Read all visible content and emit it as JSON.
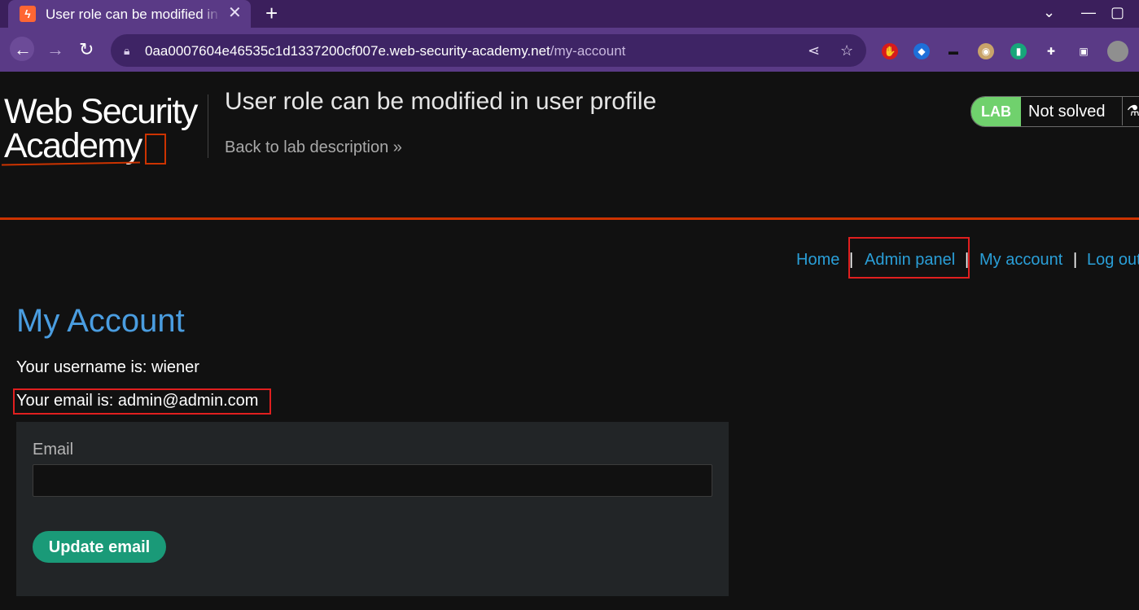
{
  "browser": {
    "tab_title": "User role can be modified in user profile",
    "tab_close": "✕",
    "new_tab": "+",
    "url_host": "0aa0007604e46535c1d1337200cf007e.web-security-academy.net",
    "url_path": "/my-account",
    "icons": [
      "back-arrow-icon",
      "forward-arrow-icon",
      "reload-icon",
      "lock-icon",
      "share-icon",
      "star-icon",
      "puzzle-icon",
      "sidebar-icon",
      "avatar"
    ],
    "window_controls": [
      "chevron-down-icon",
      "minimize-icon",
      "maximize-icon"
    ]
  },
  "header": {
    "logo_line1": "Web Security",
    "logo_line2": "Academy",
    "lab_title": "User role can be modified in user profile",
    "back_link": "Back to lab description",
    "back_chevrons": "»",
    "lab_badge": "LAB",
    "lab_status": "Not solved"
  },
  "nav": {
    "home": "Home",
    "admin_panel": "Admin panel",
    "my_account": "My account",
    "log_out": "Log out",
    "separator": "|"
  },
  "main": {
    "heading": "My Account",
    "username_line": "Your username is: wiener",
    "email_line": "Your email is: admin@admin.com",
    "email_label": "Email",
    "email_value": "",
    "update_button": "Update email"
  },
  "colors": {
    "accent_orange": "#cc3300",
    "link_blue": "#2a9fd8",
    "heading_blue": "#4a9de0",
    "lab_green": "#70d16d",
    "button_teal": "#1a9a78",
    "highlight_red": "#e01f1f"
  }
}
